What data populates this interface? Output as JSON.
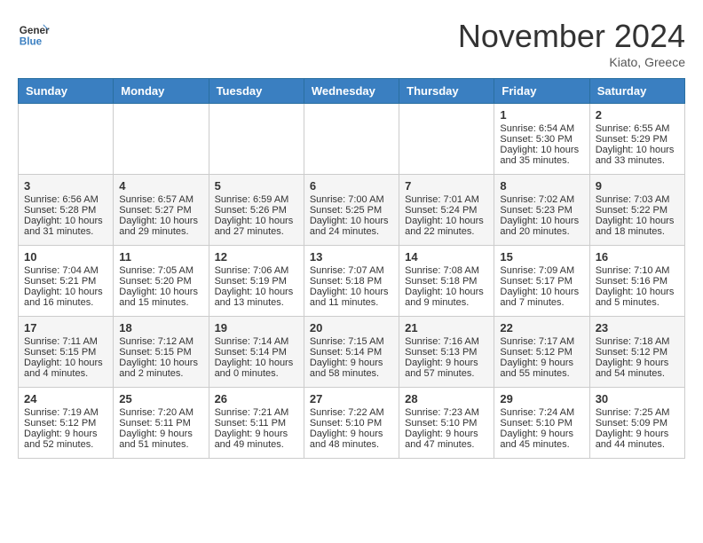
{
  "header": {
    "logo_general": "General",
    "logo_blue": "Blue",
    "month_title": "November 2024",
    "location": "Kiato, Greece"
  },
  "days_of_week": [
    "Sunday",
    "Monday",
    "Tuesday",
    "Wednesday",
    "Thursday",
    "Friday",
    "Saturday"
  ],
  "weeks": [
    [
      {
        "day": "",
        "info": ""
      },
      {
        "day": "",
        "info": ""
      },
      {
        "day": "",
        "info": ""
      },
      {
        "day": "",
        "info": ""
      },
      {
        "day": "",
        "info": ""
      },
      {
        "day": "1",
        "info": "Sunrise: 6:54 AM\nSunset: 5:30 PM\nDaylight: 10 hours and 35 minutes."
      },
      {
        "day": "2",
        "info": "Sunrise: 6:55 AM\nSunset: 5:29 PM\nDaylight: 10 hours and 33 minutes."
      }
    ],
    [
      {
        "day": "3",
        "info": "Sunrise: 6:56 AM\nSunset: 5:28 PM\nDaylight: 10 hours and 31 minutes."
      },
      {
        "day": "4",
        "info": "Sunrise: 6:57 AM\nSunset: 5:27 PM\nDaylight: 10 hours and 29 minutes."
      },
      {
        "day": "5",
        "info": "Sunrise: 6:59 AM\nSunset: 5:26 PM\nDaylight: 10 hours and 27 minutes."
      },
      {
        "day": "6",
        "info": "Sunrise: 7:00 AM\nSunset: 5:25 PM\nDaylight: 10 hours and 24 minutes."
      },
      {
        "day": "7",
        "info": "Sunrise: 7:01 AM\nSunset: 5:24 PM\nDaylight: 10 hours and 22 minutes."
      },
      {
        "day": "8",
        "info": "Sunrise: 7:02 AM\nSunset: 5:23 PM\nDaylight: 10 hours and 20 minutes."
      },
      {
        "day": "9",
        "info": "Sunrise: 7:03 AM\nSunset: 5:22 PM\nDaylight: 10 hours and 18 minutes."
      }
    ],
    [
      {
        "day": "10",
        "info": "Sunrise: 7:04 AM\nSunset: 5:21 PM\nDaylight: 10 hours and 16 minutes."
      },
      {
        "day": "11",
        "info": "Sunrise: 7:05 AM\nSunset: 5:20 PM\nDaylight: 10 hours and 15 minutes."
      },
      {
        "day": "12",
        "info": "Sunrise: 7:06 AM\nSunset: 5:19 PM\nDaylight: 10 hours and 13 minutes."
      },
      {
        "day": "13",
        "info": "Sunrise: 7:07 AM\nSunset: 5:18 PM\nDaylight: 10 hours and 11 minutes."
      },
      {
        "day": "14",
        "info": "Sunrise: 7:08 AM\nSunset: 5:18 PM\nDaylight: 10 hours and 9 minutes."
      },
      {
        "day": "15",
        "info": "Sunrise: 7:09 AM\nSunset: 5:17 PM\nDaylight: 10 hours and 7 minutes."
      },
      {
        "day": "16",
        "info": "Sunrise: 7:10 AM\nSunset: 5:16 PM\nDaylight: 10 hours and 5 minutes."
      }
    ],
    [
      {
        "day": "17",
        "info": "Sunrise: 7:11 AM\nSunset: 5:15 PM\nDaylight: 10 hours and 4 minutes."
      },
      {
        "day": "18",
        "info": "Sunrise: 7:12 AM\nSunset: 5:15 PM\nDaylight: 10 hours and 2 minutes."
      },
      {
        "day": "19",
        "info": "Sunrise: 7:14 AM\nSunset: 5:14 PM\nDaylight: 10 hours and 0 minutes."
      },
      {
        "day": "20",
        "info": "Sunrise: 7:15 AM\nSunset: 5:14 PM\nDaylight: 9 hours and 58 minutes."
      },
      {
        "day": "21",
        "info": "Sunrise: 7:16 AM\nSunset: 5:13 PM\nDaylight: 9 hours and 57 minutes."
      },
      {
        "day": "22",
        "info": "Sunrise: 7:17 AM\nSunset: 5:12 PM\nDaylight: 9 hours and 55 minutes."
      },
      {
        "day": "23",
        "info": "Sunrise: 7:18 AM\nSunset: 5:12 PM\nDaylight: 9 hours and 54 minutes."
      }
    ],
    [
      {
        "day": "24",
        "info": "Sunrise: 7:19 AM\nSunset: 5:12 PM\nDaylight: 9 hours and 52 minutes."
      },
      {
        "day": "25",
        "info": "Sunrise: 7:20 AM\nSunset: 5:11 PM\nDaylight: 9 hours and 51 minutes."
      },
      {
        "day": "26",
        "info": "Sunrise: 7:21 AM\nSunset: 5:11 PM\nDaylight: 9 hours and 49 minutes."
      },
      {
        "day": "27",
        "info": "Sunrise: 7:22 AM\nSunset: 5:10 PM\nDaylight: 9 hours and 48 minutes."
      },
      {
        "day": "28",
        "info": "Sunrise: 7:23 AM\nSunset: 5:10 PM\nDaylight: 9 hours and 47 minutes."
      },
      {
        "day": "29",
        "info": "Sunrise: 7:24 AM\nSunset: 5:10 PM\nDaylight: 9 hours and 45 minutes."
      },
      {
        "day": "30",
        "info": "Sunrise: 7:25 AM\nSunset: 5:09 PM\nDaylight: 9 hours and 44 minutes."
      }
    ]
  ]
}
